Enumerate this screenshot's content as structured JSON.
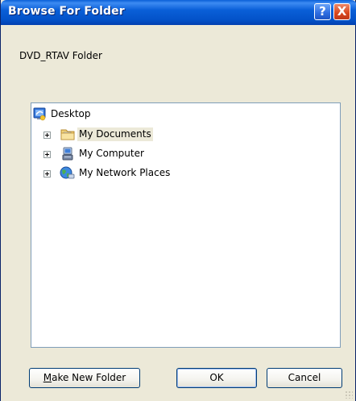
{
  "window": {
    "title": "Browse For Folder",
    "help_glyph": "?",
    "close_glyph": "X",
    "instruction": "DVD_RTAV Folder"
  },
  "tree": {
    "root": {
      "label": "Desktop",
      "icon": "desktop-icon"
    },
    "items": [
      {
        "label": "My Documents",
        "icon": "my-documents-folder-icon",
        "selected": true
      },
      {
        "label": "My Computer",
        "icon": "my-computer-icon",
        "selected": false
      },
      {
        "label": "My Network Places",
        "icon": "network-places-icon",
        "selected": false
      }
    ]
  },
  "buttons": {
    "make_new_folder_mnemonic": "M",
    "make_new_folder_rest": "ake New Folder",
    "ok": "OK",
    "cancel": "Cancel"
  },
  "colors": {
    "titlebar": "#0a5fd8",
    "dialog_bg": "#ece9d8",
    "tree_border": "#7f9db9"
  }
}
